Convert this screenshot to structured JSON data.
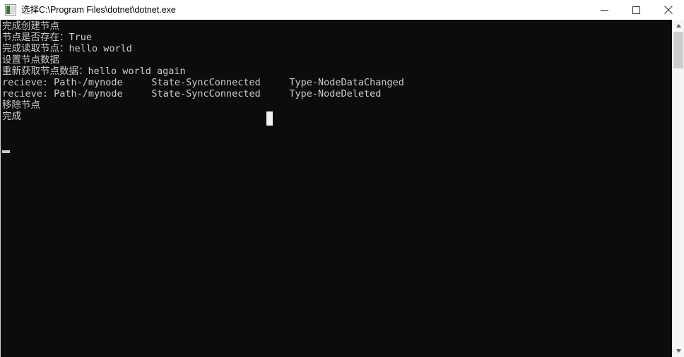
{
  "window": {
    "title": "选择C:\\Program Files\\dotnet\\dotnet.exe",
    "icon": "console-app-icon",
    "background_color": "#ffffff"
  },
  "titlebar": {
    "minimize_label": "minimize",
    "maximize_label": "maximize",
    "close_label": "close"
  },
  "console": {
    "background_color": "#0c0c0c",
    "foreground_color": "#cccccc",
    "lines": [
      "完成创建节点",
      "节点是否存在：True",
      "完成读取节点：hello world",
      "设置节点数据",
      "重新获取节点数据：hello world again",
      "recieve: Path-/mynode     State-SyncConnected     Type-NodeDataChanged",
      "recieve: Path-/mynode     State-SyncConnected     Type-NodeDeleted",
      "移除节点",
      "完成"
    ],
    "text": "完成创建节点\n节点是否存在：True\n完成读取节点：hello world\n设置节点数据\n重新获取节点数据：hello world again\nrecieve: Path-/mynode     State-SyncConnected     Type-NodeDataChanged\nrecieve: Path-/mynode     State-SyncConnected     Type-NodeDeleted\n移除节点\n完成",
    "caret": "_",
    "mouse_pointer": "text-ibeam-cursor"
  },
  "scrollbar": {
    "orientation": "vertical",
    "up_arrow": "scroll-up",
    "down_arrow": "scroll-down",
    "thumb_color": "#cdcdcd",
    "track_color": "#f5f5f5"
  }
}
